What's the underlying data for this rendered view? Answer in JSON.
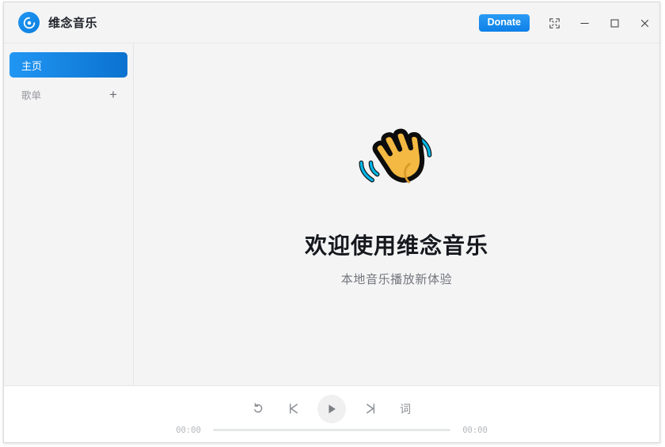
{
  "app": {
    "title": "维念音乐",
    "logo_icon": "music-disc-icon"
  },
  "titlebar": {
    "donate_label": "Donate",
    "buttons": [
      {
        "name": "shrink-to-mini-icon",
        "tooltip": ""
      },
      {
        "name": "minimize-icon",
        "tooltip": ""
      },
      {
        "name": "maximize-icon",
        "tooltip": ""
      },
      {
        "name": "close-icon",
        "tooltip": ""
      }
    ]
  },
  "sidebar": {
    "items": [
      {
        "label": "主页",
        "active": true
      }
    ],
    "section": {
      "label": "歌单",
      "add_label": "+"
    }
  },
  "main": {
    "emoji": "waving-hand",
    "title": "欢迎使用维念音乐",
    "subtitle": "本地音乐播放新体验"
  },
  "player": {
    "repeat_icon": "repeat-icon",
    "prev_icon": "previous-track-icon",
    "play_icon": "play-icon",
    "next_icon": "next-track-icon",
    "lyrics_label": "词",
    "current_time": "00:00",
    "total_time": "00:00",
    "progress_percent": 0
  },
  "colors": {
    "accent": "#2196f3",
    "accent_dark": "#0b72cf",
    "titlebar_bg": "#f4f4f5",
    "content_bg": "#f4f4f5",
    "player_bg": "#ffffff",
    "text_primary": "#15181d",
    "text_muted": "#72757b",
    "emoji_hand": "#f4b942",
    "emoji_motion": "#00b3e3"
  }
}
